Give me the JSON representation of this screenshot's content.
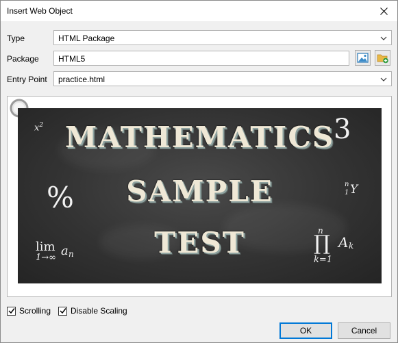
{
  "dialog": {
    "title": "Insert Web Object"
  },
  "form": {
    "type_label": "Type",
    "type_value": "HTML Package",
    "package_label": "Package",
    "package_value": "HTML5",
    "entry_label": "Entry Point",
    "entry_value": "practice.html"
  },
  "preview": {
    "line1": "MATHEMATICS",
    "line2": "SAMPLE",
    "line3": "TEST",
    "math_x2_base": "x",
    "math_x2_exp": "2",
    "math_three": "3",
    "math_percent": "%",
    "math_ny_top": "n",
    "math_ny_bottom": "1",
    "math_ny_main": "Y",
    "math_lim": "lim",
    "math_lim_sub": "1→∞",
    "math_lim_a": "a",
    "math_lim_n": "n",
    "math_prod_top": "n",
    "math_prod": "∏",
    "math_prod_bottom": "k=1",
    "math_prod_a": "A",
    "math_prod_k": "k"
  },
  "options": {
    "scrolling_label": "Scrolling",
    "scrolling_checked": true,
    "disable_scaling_label": "Disable Scaling",
    "disable_scaling_checked": true
  },
  "buttons": {
    "ok_label": "OK",
    "cancel_label": "Cancel"
  },
  "colors": {
    "accent": "#0078d7",
    "board": "#333333",
    "chalk": "#efe8d6"
  }
}
